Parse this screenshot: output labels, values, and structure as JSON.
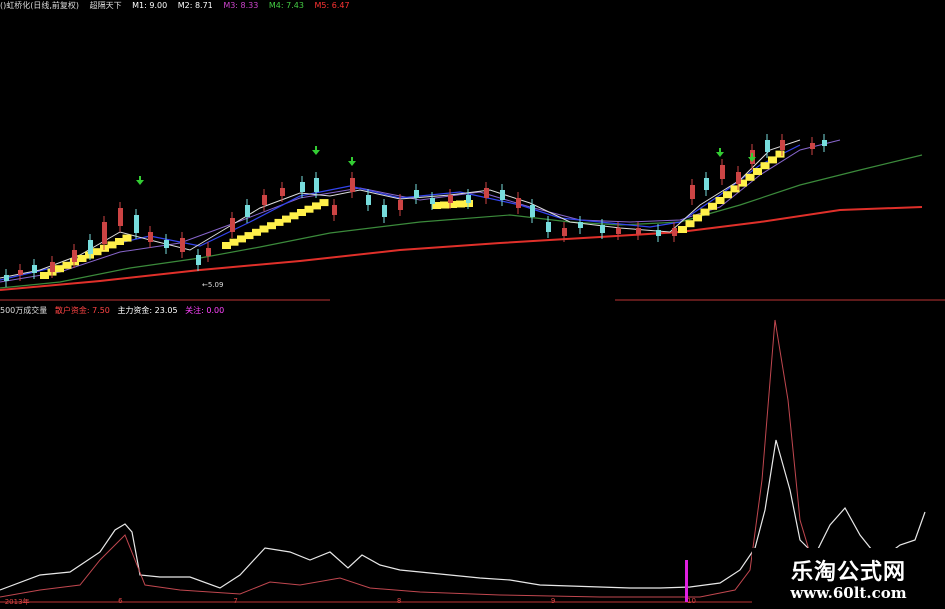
{
  "main_header": {
    "title": "()虹桥化(日线,前复权)",
    "indicator": "超隔天下",
    "ma": [
      {
        "label": "M1: 9.00",
        "color": "#ffffff"
      },
      {
        "label": "M2: 8.71",
        "color": "#ffffff"
      },
      {
        "label": "M3: 8.33",
        "color": "#cc44cc"
      },
      {
        "label": "M4: 7.43",
        "color": "#44cc44"
      },
      {
        "label": "M5: 6.47",
        "color": "#ff3333"
      }
    ]
  },
  "sub_header": {
    "title": "500万成交量",
    "items": [
      {
        "label": "散户资金: 7.50",
        "color": "#ff4444"
      },
      {
        "label": "主力资金: 23.05",
        "color": "#ffffff"
      },
      {
        "label": "关注: 0.00",
        "color": "#ff44ff"
      }
    ]
  },
  "low_label": "←5.09",
  "date_labels": [
    {
      "text": "2013年",
      "pos": 0.005
    },
    {
      "text": "6",
      "pos": 0.125
    },
    {
      "text": "7",
      "pos": 0.247
    },
    {
      "text": "8",
      "pos": 0.42
    },
    {
      "text": "9",
      "pos": 0.583
    },
    {
      "text": "10",
      "pos": 0.727
    }
  ],
  "watermark": {
    "title": "乐淘公式网",
    "url": "www.60lt.com"
  },
  "chart_data": [
    {
      "type": "line",
      "title": "()虹桥化(日线,前复权) 超隔天下",
      "series": [
        {
          "name": "M1",
          "values": [
            9.0
          ]
        },
        {
          "name": "M2",
          "values": [
            8.71
          ]
        },
        {
          "name": "M3",
          "values": [
            8.33
          ]
        },
        {
          "name": "M4",
          "values": [
            7.43
          ]
        },
        {
          "name": "M5",
          "values": [
            6.47
          ]
        }
      ]
    },
    {
      "type": "line",
      "title": "500万成交量",
      "series": [
        {
          "name": "散户资金",
          "values": [
            7.5
          ]
        },
        {
          "name": "主力资金",
          "values": [
            23.05
          ]
        },
        {
          "name": "关注",
          "values": [
            0.0
          ]
        }
      ]
    }
  ]
}
